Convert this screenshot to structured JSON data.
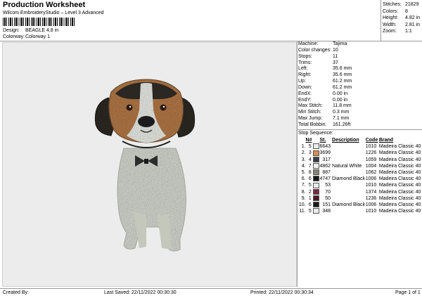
{
  "header": {
    "title": "Production Worksheet",
    "subtitle": "Wilcom EmbroideryStudio – Level 3 Advanced",
    "design_label": "Design:",
    "design_value": "BEAGLE 4,8 in",
    "colorway_label": "Colorway:",
    "colorway_value": "Colorway 1"
  },
  "stats": [
    {
      "k": "Stitches:",
      "v": "21829"
    },
    {
      "k": "Colors:",
      "v": "8"
    },
    {
      "k": "Height:",
      "v": "4.82 in"
    },
    {
      "k": "Width:",
      "v": "2.81 in"
    },
    {
      "k": "Zoom:",
      "v": "1:1"
    }
  ],
  "info": [
    {
      "k": "Machine:",
      "v": "Tajima"
    },
    {
      "k": "Color changes:",
      "v": "10"
    },
    {
      "k": "Stops:",
      "v": "11"
    },
    {
      "k": "Trims:",
      "v": "37"
    },
    {
      "k": "Left:",
      "v": "35.6 mm"
    },
    {
      "k": "Right:",
      "v": "35.6 mm"
    },
    {
      "k": "Up:",
      "v": "61.2 mm"
    },
    {
      "k": "Down:",
      "v": "61.2 mm"
    },
    {
      "k": "EndX:",
      "v": "0.00 in"
    },
    {
      "k": "EndY:",
      "v": "0.00 in"
    },
    {
      "k": "Max Stitch:",
      "v": "11.8 mm"
    },
    {
      "k": "Min Stitch:",
      "v": "0.3 mm"
    },
    {
      "k": "Max Jump:",
      "v": "7.1 mm"
    },
    {
      "k": "Total Bobbin:",
      "v": "161.26ft"
    }
  ],
  "sequence": {
    "title": "Stop Sequence:",
    "headers": [
      "N#",
      "St.",
      "Description",
      "Code",
      "Brand"
    ],
    "rows": [
      {
        "i": "1.",
        "n": "5",
        "color": "#ececec",
        "st": "6643",
        "desc": "",
        "code": "1010",
        "brand": "Madeira Classic 40"
      },
      {
        "i": "2.",
        "n": "3",
        "color": "#d98b52",
        "st": "3699",
        "desc": "",
        "code": "1226",
        "brand": "Madeira Classic 40"
      },
      {
        "i": "3.",
        "n": "4",
        "color": "#3a3f46",
        "st": "317",
        "desc": "",
        "code": "1059",
        "brand": "Madeira Classic 40"
      },
      {
        "i": "4.",
        "n": "7",
        "color": "#f4f4f0",
        "st": "4862",
        "desc": "Natural White",
        "code": "1004",
        "brand": "Madeira Classic 40"
      },
      {
        "i": "5.",
        "n": "8",
        "color": "#8a8172",
        "st": "887",
        "desc": "",
        "code": "1062",
        "brand": "Madeira Classic 40"
      },
      {
        "i": "6.",
        "n": "6",
        "color": "#1a1a1a",
        "st": "4747",
        "desc": "Diamond Black",
        "code": "1006",
        "brand": "Madeira Classic 40"
      },
      {
        "i": "7.",
        "n": "5",
        "color": "#ececec",
        "st": "53",
        "desc": "",
        "code": "1010",
        "brand": "Madeira Classic 40"
      },
      {
        "i": "8.",
        "n": "2",
        "color": "#7a2a3a",
        "st": "70",
        "desc": "",
        "code": "1374",
        "brand": "Madeira Classic 40"
      },
      {
        "i": "9.",
        "n": "1",
        "color": "#4a1824",
        "st": "50",
        "desc": "",
        "code": "1236",
        "brand": "Madeira Classic 40"
      },
      {
        "i": "10.",
        "n": "6",
        "color": "#1a1a1a",
        "st": "151",
        "desc": "Diamond Black",
        "code": "1006",
        "brand": "Madeira Classic 40"
      },
      {
        "i": "11.",
        "n": "5",
        "color": "#ececec",
        "st": "348",
        "desc": "",
        "code": "1010",
        "brand": "Madeira Classic 40"
      }
    ]
  },
  "footer": {
    "created": "Created By:",
    "saved": "Last Saved: 22/11/2022 00:30:30",
    "printed": "Printed: 22/11/2022 00:30:34",
    "page": "Page 1 of 1"
  }
}
